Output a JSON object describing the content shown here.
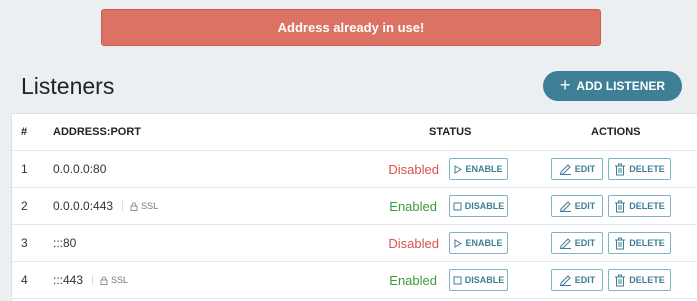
{
  "alert": {
    "message": "Address already in use!"
  },
  "page": {
    "title": "Listeners"
  },
  "toolbar": {
    "add_label": "ADD LISTENER",
    "add_icon": "plus-icon"
  },
  "table": {
    "headers": {
      "num": "#",
      "address": "ADDRESS:PORT",
      "status": "STATUS",
      "actions": "ACTIONS"
    },
    "rows": [
      {
        "num": "1",
        "address": "0.0.0.0:80",
        "ssl": "",
        "status": "Disabled",
        "toggle": "ENABLE",
        "edit": "EDIT",
        "delete": "DELETE"
      },
      {
        "num": "2",
        "address": "0.0.0.0:443",
        "ssl": "SSL",
        "status": "Enabled",
        "toggle": "DISABLE",
        "edit": "EDIT",
        "delete": "DELETE"
      },
      {
        "num": "3",
        "address": ":::80",
        "ssl": "",
        "status": "Disabled",
        "toggle": "ENABLE",
        "edit": "EDIT",
        "delete": "DELETE"
      },
      {
        "num": "4",
        "address": ":::443",
        "ssl": "SSL",
        "status": "Enabled",
        "toggle": "DISABLE",
        "edit": "EDIT",
        "delete": "DELETE"
      }
    ]
  },
  "colors": {
    "alert": "#dc7263",
    "accent": "#3f7f96",
    "disabled": "#d9534f",
    "enabled": "#3c9a3c"
  }
}
